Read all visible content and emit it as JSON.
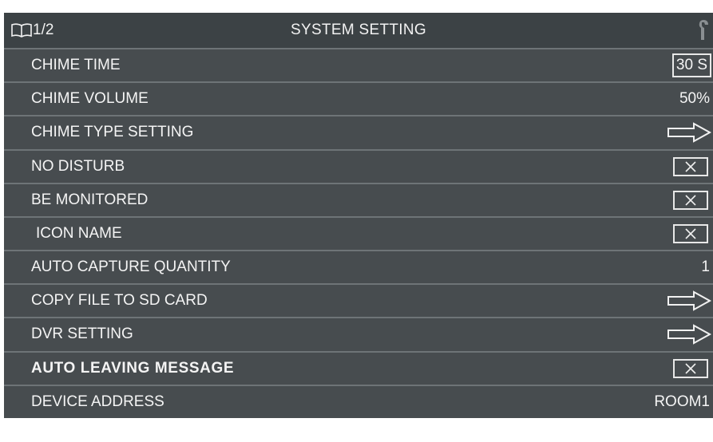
{
  "header": {
    "book_icon": "book-icon",
    "page_indicator": "1/2",
    "title": "SYSTEM SETTING",
    "wrench_icon": "wrench-icon"
  },
  "colors": {
    "header_bg": "#3c4245",
    "row_bg": "#474c4f",
    "separator": "#6e7477",
    "text": "#f4f4f4"
  },
  "settings": [
    {
      "label": "CHIME TIME",
      "control": "value-box",
      "value": "30 S"
    },
    {
      "label": "CHIME VOLUME",
      "control": "value",
      "value": "50%"
    },
    {
      "label": "CHIME TYPE SETTING",
      "control": "arrow",
      "icon": "arrow-right-icon"
    },
    {
      "label": "NO DISTURB",
      "control": "checkbox",
      "checked": false,
      "icon": "x-mark-icon"
    },
    {
      "label": "BE MONITORED",
      "control": "checkbox",
      "checked": false,
      "icon": "x-mark-icon"
    },
    {
      "label": "ICON NAME",
      "control": "checkbox",
      "checked": false,
      "icon": "x-mark-icon"
    },
    {
      "label": "AUTO CAPTURE QUANTITY",
      "control": "value",
      "value": "1"
    },
    {
      "label": "COPY FILE TO SD CARD",
      "control": "arrow",
      "icon": "arrow-right-icon"
    },
    {
      "label": "DVR SETTING",
      "control": "arrow",
      "icon": "arrow-right-icon"
    },
    {
      "label": "AUTO LEAVING MESSAGE",
      "control": "checkbox",
      "checked": false,
      "icon": "x-mark-icon"
    },
    {
      "label": "DEVICE ADDRESS",
      "control": "value",
      "value": "ROOM1"
    }
  ]
}
